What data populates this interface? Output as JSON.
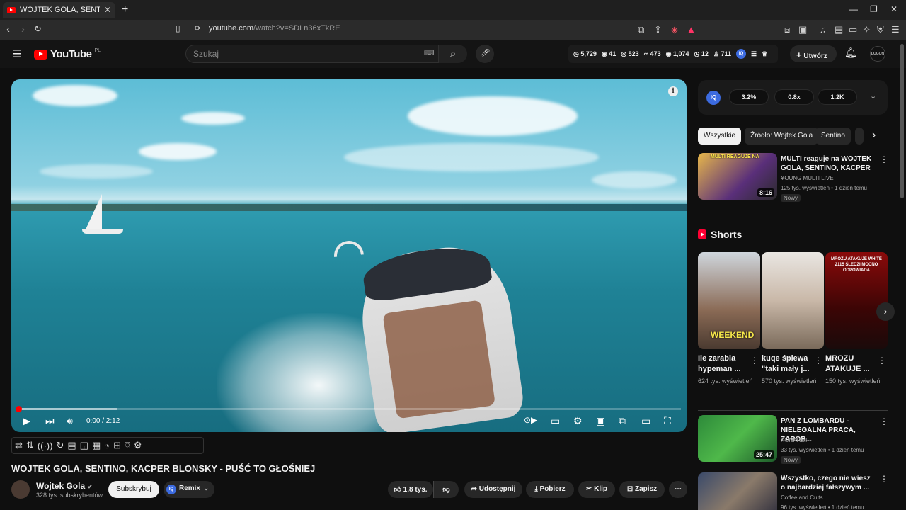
{
  "browser": {
    "tab_title": "WOJTEK GOLA, SENTINO, KACPER BLONSKY - PUŚĆ TO GŁOŚNIEJ",
    "url_host": "youtube.com",
    "url_path": "/watch?v=SDLn36xTkRE"
  },
  "header": {
    "logo_text": "YouTube",
    "logo_region": "PL",
    "search_placeholder": "Szukaj",
    "create_label": "Utwórz",
    "avatar_text": "LOGON",
    "stats": [
      "5,729",
      "41",
      "523",
      "473",
      "1,074",
      "12",
      "711"
    ]
  },
  "player": {
    "time": "0:00 / 2:12",
    "progress_loaded": 0.15,
    "progress_played": 0.0
  },
  "video": {
    "title": "WOJTEK GOLA, SENTINO, KACPER BLONSKY - PUŚĆ TO GŁOŚNIEJ",
    "channel": "Wojtek Gola",
    "subscribers": "328 tys. subskrybentów",
    "subscribe_label": "Subskrybuj",
    "remix_label": "Remix",
    "likes": "1,8 tys.",
    "share_label": "Udostępnij",
    "download_label": "Pobierz",
    "clip_label": "Klip",
    "save_label": "Zapisz"
  },
  "iq_panel": {
    "badge": "IQ",
    "values": [
      "3.2%",
      "0.8x",
      "1.2K"
    ]
  },
  "chips": [
    "Wszystkie",
    "Źródło: Wojtek Gola",
    "Sentino"
  ],
  "recommendations_top": {
    "title": "MULTI reaguje na WOJTEK GOLA, SENTINO, KACPER ...",
    "channel": "YOUNG MULTI LIVE",
    "meta": "125 tys. wyświetleń • 1 dzień temu",
    "badge": "Nowy",
    "duration": "8:16",
    "thumb_text": "MULTI REAGUJE NA"
  },
  "shorts": {
    "heading": "Shorts",
    "items": [
      {
        "title": "Ile zarabia hypeman ...",
        "views": "624 tys. wyświetleń",
        "thumb_text": "WEEKEND"
      },
      {
        "title": "kuqe śpiewa \"taki mały j...",
        "views": "570 tys. wyświetleń",
        "thumb_text": ""
      },
      {
        "title": "MROZU ATAKUJE ...",
        "views": "150 tys. wyświetleń",
        "thumb_text": "MROZU ATAKUJE WHITE 2115 ŚLEDZI MOCNO ODPOWIADA"
      }
    ]
  },
  "recommendations": [
    {
      "title": "PAN Z LOMBARDU - NIELEGALNA PRACA, ZAROB...",
      "channel": "KONKRET",
      "meta": "33 tys. wyświetleń • 1 dzień temu",
      "badge": "Nowy",
      "duration": "25:47"
    },
    {
      "title": "Wszystko, czego nie wiesz o najbardziej fałszywym ...",
      "channel": "Coffee and Cults",
      "meta": "96 tys. wyświetleń • 1 dzień temu",
      "badge": "",
      "duration": ""
    }
  ]
}
